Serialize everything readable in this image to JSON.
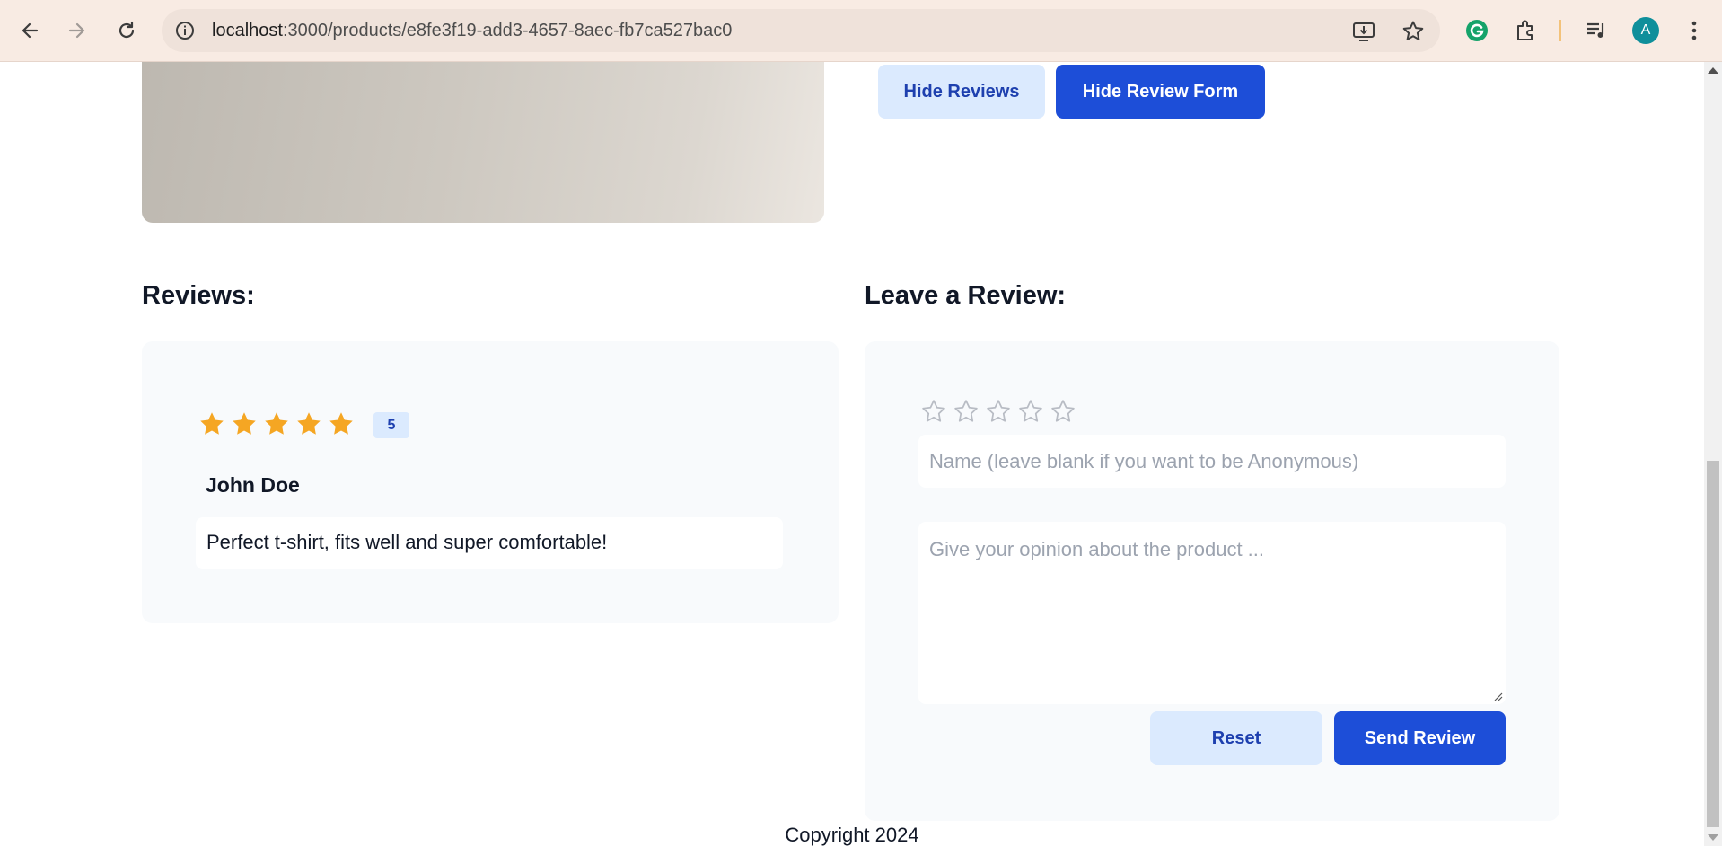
{
  "browser": {
    "url_host": "localhost",
    "url_rest": ":3000/products/e8fe3f19-add3-4657-8aec-fb7ca527bac0",
    "avatar_letter": "A",
    "icons": [
      "back-icon",
      "forward-icon",
      "reload-icon",
      "site-info-icon",
      "install-app-icon",
      "bookmark-star-icon",
      "grammarly-icon",
      "extensions-icon",
      "media-controls-icon",
      "avatar",
      "menu-kebab-icon"
    ]
  },
  "product": {
    "hide_reviews_label": "Hide Reviews",
    "hide_form_label": "Hide Review Form"
  },
  "reviews": {
    "heading": "Reviews:",
    "items": [
      {
        "rating": 5,
        "rating_label": "5",
        "author": "John Doe",
        "text": "Perfect t-shirt, fits well and super comfortable!"
      }
    ]
  },
  "review_form": {
    "heading": "Leave a Review:",
    "selected_rating": 0,
    "max_rating": 5,
    "name_value": "",
    "name_placeholder": "Name (leave blank if you want to be Anonymous)",
    "opinion_value": "",
    "opinion_placeholder": "Give your opinion about the product ...",
    "reset_label": "Reset",
    "submit_label": "Send Review"
  },
  "footer": {
    "text": "Copyright 2024"
  },
  "colors": {
    "star_filled": "#f5a623",
    "star_empty": "#b8bcc4",
    "primary": "#1d4ed8",
    "primary_light": "#dbeafe"
  }
}
